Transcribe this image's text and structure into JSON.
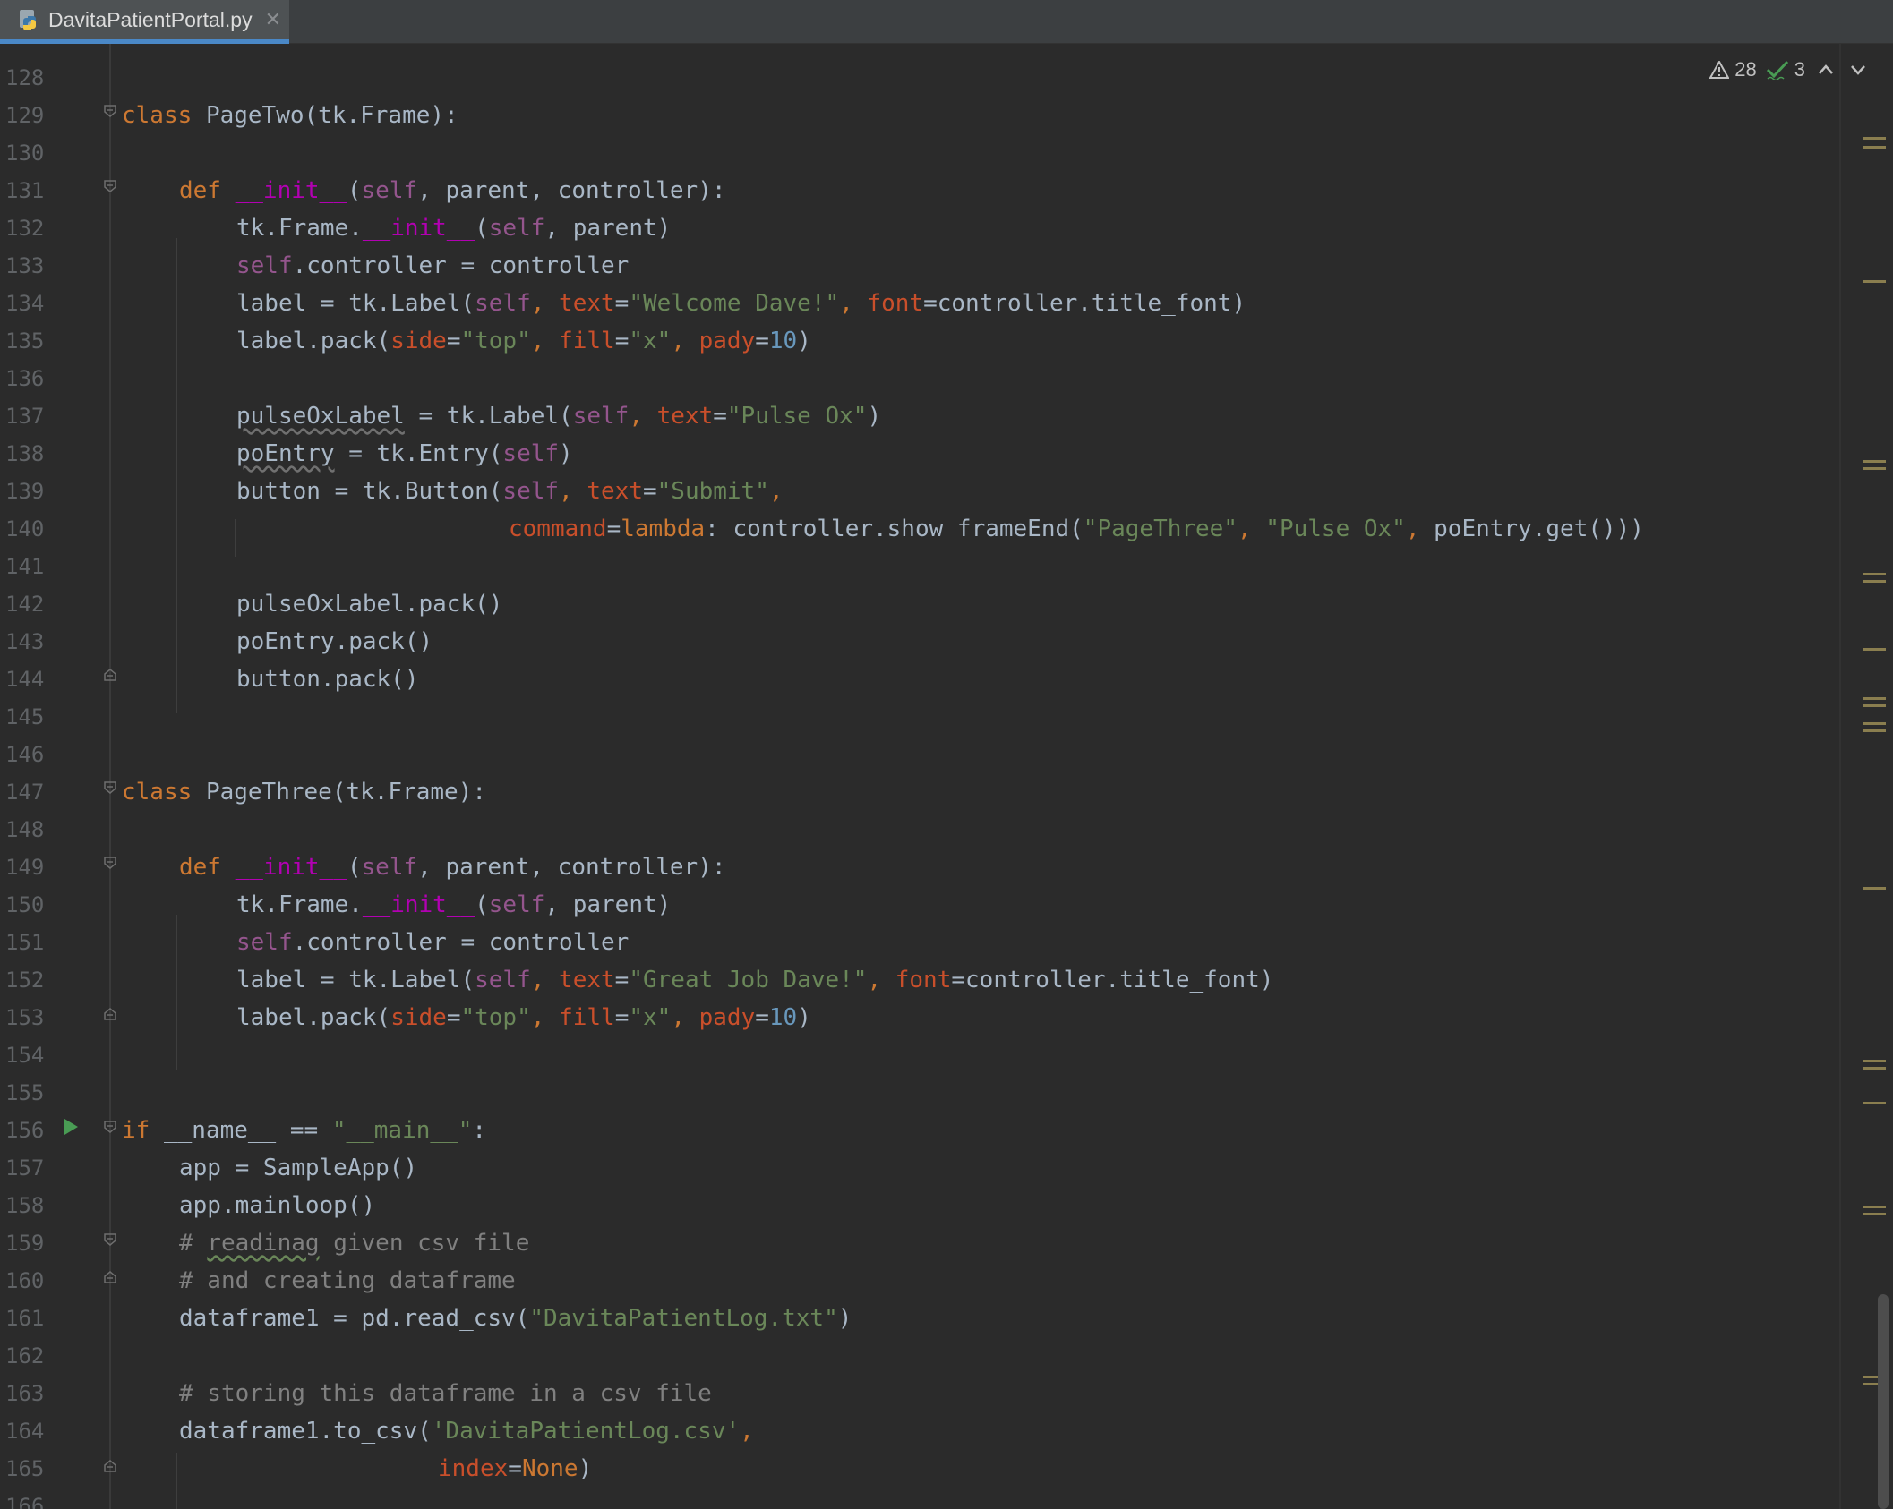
{
  "tab": {
    "filename": "DavitaPatientPortal.py",
    "close": "✕",
    "icon": "python-file-icon"
  },
  "inspections": {
    "warnings": "28",
    "typos": "3",
    "warning_icon": "warning-icon",
    "typo_icon": "typo-check-icon"
  },
  "lines": {
    "l128": "128",
    "l129": "129",
    "l130": "130",
    "l131": "131",
    "l132": "132",
    "l133": "133",
    "l134": "134",
    "l135": "135",
    "l136": "136",
    "l137": "137",
    "l138": "138",
    "l139": "139",
    "l140": "140",
    "l141": "141",
    "l142": "142",
    "l143": "143",
    "l144": "144",
    "l145": "145",
    "l146": "146",
    "l147": "147",
    "l148": "148",
    "l149": "149",
    "l150": "150",
    "l151": "151",
    "l152": "152",
    "l153": "153",
    "l154": "154",
    "l155": "155",
    "l156": "156",
    "l157": "157",
    "l158": "158",
    "l159": "159",
    "l160": "160",
    "l161": "161",
    "l162": "162",
    "l163": "163",
    "l164": "164",
    "l165": "165",
    "l166": "166"
  },
  "code": {
    "kw_class": "class",
    "kw_def": "def",
    "kw_if": "if",
    "kw_lambda": "lambda",
    "kw_none": "None",
    "self": "self",
    "init": "__init__",
    "cls_page_two": "PageTwo(tk.Frame):",
    "cls_page_three": "PageThree(tk.Frame):",
    "params_open": "(",
    "params_rest": ", parent, controller):",
    "frame_init_a": "tk.Frame.",
    "frame_init_b": "(",
    "frame_init_c": ", parent)",
    "ctrl_assign": ".controller = controller",
    "label_a": "label = tk.Label(",
    "comma": ", ",
    "p_text": "text",
    "eq": "=",
    "s_welcome": "\"Welcome Dave!\"",
    "s_great": "\"Great Job Dave!\"",
    "p_font": "font",
    "font_val": "=controller.title_font)",
    "pack_a": "label.pack(",
    "p_side": "side",
    "s_top": "\"top\"",
    "p_fill": "fill",
    "s_x": "\"x\"",
    "p_pady": "pady",
    "n_10": "10",
    "close_paren": ")",
    "pulse_var": "pulseOxLabel",
    "pulse_rest": " = tk.Label(",
    "s_pulse": "\"Pulse Ox\"",
    "po_var": "poEntry",
    "po_rest": " = tk.Entry(",
    "btn_a": "button = tk.Button(",
    "s_submit": "\"Submit\"",
    "trail_comma": ",",
    "p_command": "command",
    "cmd_rest_a": ": controller.show_frameEnd(",
    "s_page_three": "\"PageThree\"",
    "cmd_rest_b": "poEntry.get()))",
    "pack_pulse": "pulseOxLabel.pack()",
    "pack_po": "poEntry.pack()",
    "pack_btn": "button.pack()",
    "name_check": " __name__ == ",
    "s_main": "\"__main__\"",
    "colon": ":",
    "app_assign": "app = SampleApp()",
    "app_loop": "app.mainloop()",
    "cmt_hash": "# ",
    "cmt_readinag": "readinag",
    "cmt_given": " given csv file",
    "cmt_creating": "# and creating dataframe",
    "read_a": "dataframe1 = pd.read_csv(",
    "s_log_txt": "\"DavitaPatientLog.txt\"",
    "cmt_storing": "# storing this dataframe in a csv file",
    "tocsv_a": "dataframe1.to_csv(",
    "s_log_csv": "'DavitaPatientLog.csv'",
    "p_index": "index"
  },
  "colors": {
    "background": "#2b2b2b",
    "keyword": "#cc7832",
    "string": "#6a8759",
    "number": "#6897bb",
    "self": "#94558d",
    "magic": "#b200b2",
    "param": "#c94f2b"
  }
}
